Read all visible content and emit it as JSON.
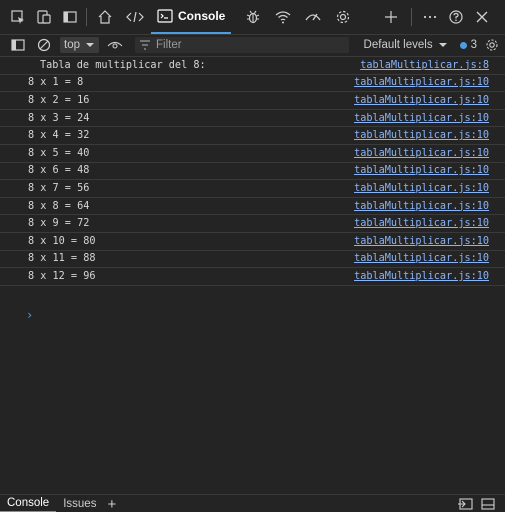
{
  "toolbar": {
    "tab_label": "Console",
    "icons": [
      "inspect-icon",
      "device-emulation-icon",
      "sidebar-toggle-icon",
      "home-icon",
      "elements-code-icon",
      "console-icon",
      "bug-icon",
      "wifi-icon",
      "performance-icon",
      "settings-gear-icon",
      "add-tab-icon",
      "more-icon",
      "help-icon",
      "close-icon"
    ]
  },
  "toolbar2": {
    "context": "top",
    "filter_placeholder": "Filter",
    "levels_label": "Default levels",
    "issues_count": "3"
  },
  "console": {
    "rows": [
      {
        "text": "Tabla de multiplicar del 8:",
        "source": "tablaMultiplicar.js:8"
      },
      {
        "text": "8 x 1 = 8",
        "source": "tablaMultiplicar.js:10"
      },
      {
        "text": "8 x 2 = 16",
        "source": "tablaMultiplicar.js:10"
      },
      {
        "text": "8 x 3 = 24",
        "source": "tablaMultiplicar.js:10"
      },
      {
        "text": "8 x 4 = 32",
        "source": "tablaMultiplicar.js:10"
      },
      {
        "text": "8 x 5 = 40",
        "source": "tablaMultiplicar.js:10"
      },
      {
        "text": "8 x 6 = 48",
        "source": "tablaMultiplicar.js:10"
      },
      {
        "text": "8 x 7 = 56",
        "source": "tablaMultiplicar.js:10"
      },
      {
        "text": "8 x 8 = 64",
        "source": "tablaMultiplicar.js:10"
      },
      {
        "text": "8 x 9 = 72",
        "source": "tablaMultiplicar.js:10"
      },
      {
        "text": "8 x 10 = 80",
        "source": "tablaMultiplicar.js:10"
      },
      {
        "text": "8 x 11 = 88",
        "source": "tablaMultiplicar.js:10"
      },
      {
        "text": "8 x 12 = 96",
        "source": "tablaMultiplicar.js:10"
      }
    ],
    "prompt": "›"
  },
  "drawer": {
    "tabs": [
      "Console",
      "Issues"
    ],
    "add": "+"
  },
  "colors": {
    "background": "#242424",
    "accent": "#4d9de0",
    "link": "#8ab4f8",
    "text": "#cccccc"
  }
}
